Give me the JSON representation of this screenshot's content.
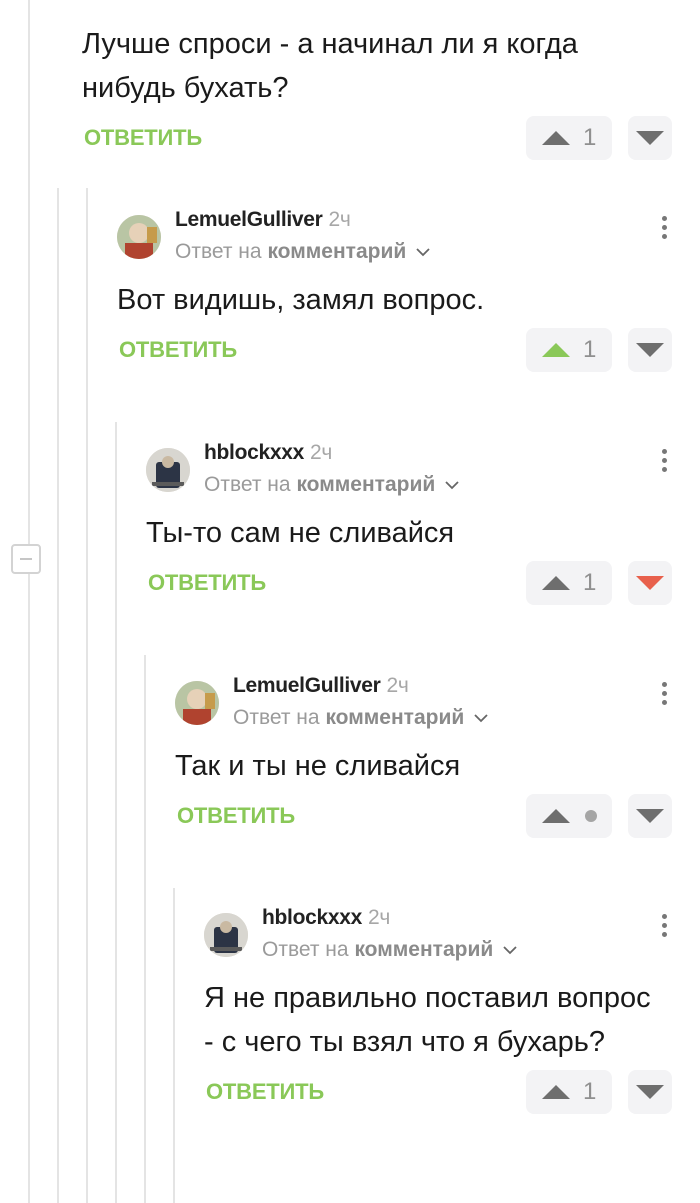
{
  "comments": [
    {
      "text": "Лучше спроси - а начинал ли я когда нибудь бухать?",
      "reply_label": "ОТВЕТИТЬ",
      "rating": "1",
      "upvoted": false,
      "downvoted": false
    },
    {
      "author": "LemuelGulliver",
      "time": "2ч",
      "reply_prefix": "Ответ на",
      "reply_target": "комментарий",
      "text": "Вот видишь, замял вопрос.",
      "reply_label": "ОТВЕТИТЬ",
      "rating": "1",
      "upvoted": true,
      "downvoted": false
    },
    {
      "author": "hblockxxx",
      "time": "2ч",
      "reply_prefix": "Ответ на",
      "reply_target": "комментарий",
      "text": "Ты-то сам не сливайся",
      "reply_label": "ОТВЕТИТЬ",
      "rating": "1",
      "upvoted": false,
      "downvoted": true
    },
    {
      "author": "LemuelGulliver",
      "time": "2ч",
      "reply_prefix": "Ответ на",
      "reply_target": "комментарий",
      "text": "Так и ты не сливайся",
      "reply_label": "ОТВЕТИТЬ",
      "rating": null,
      "upvoted": false,
      "downvoted": false
    },
    {
      "author": "hblockxxx",
      "time": "2ч",
      "reply_prefix": "Ответ на",
      "reply_target": "комментарий",
      "text": "Я не правильно поставил вопрос - с чего ты взял что я бухарь?",
      "reply_label": "ОТВЕТИТЬ",
      "rating": "1",
      "upvoted": false,
      "downvoted": false
    }
  ],
  "colors": {
    "reply_green": "#8ac858",
    "upvote_active": "#8ac858",
    "downvote_active": "#e8604c",
    "vote_inactive": "#6e6e6e"
  },
  "icons": {
    "more": "more-vertical-icon",
    "chevron": "chevron-down-icon",
    "upvote": "arrow-up-icon",
    "downvote": "arrow-down-icon",
    "collapse": "minus-icon"
  }
}
